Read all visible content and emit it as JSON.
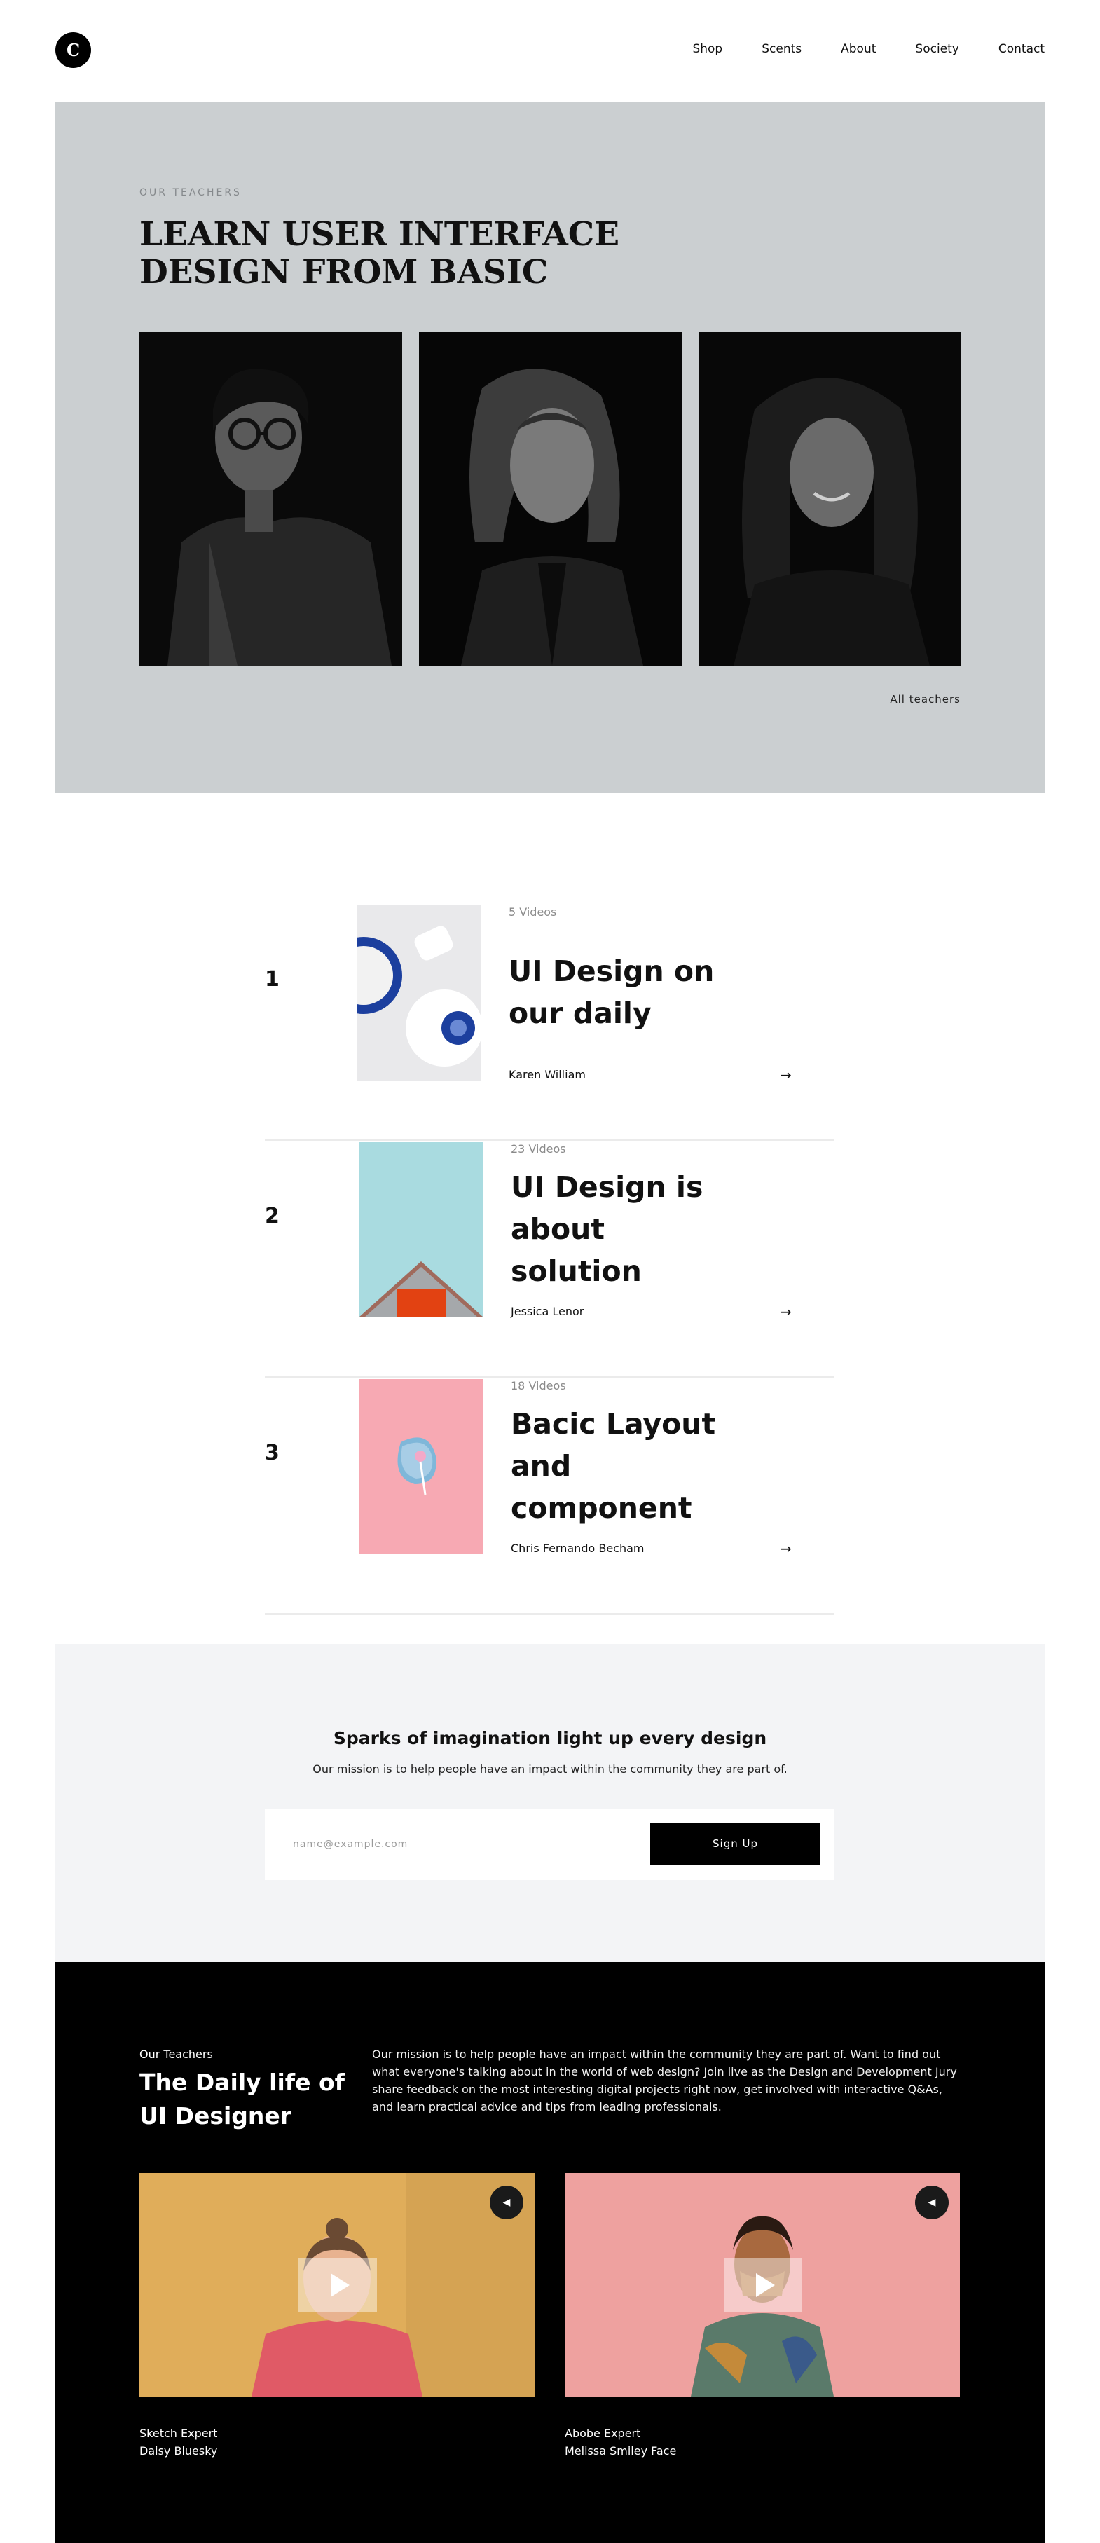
{
  "header": {
    "logo_letter": "C",
    "nav": [
      "Shop",
      "Scents",
      "About",
      "Society",
      "Contact"
    ]
  },
  "hero": {
    "eyebrow": "OUR TEACHERS",
    "title": "LEARN USER INTERFACE DESIGN FROM BASIC",
    "all_link": "All teachers",
    "background_color": "#cbcfd1"
  },
  "courses": [
    {
      "number": "1",
      "videos": "5 Videos",
      "title": "UI Design on our daily",
      "author": "Karen William"
    },
    {
      "number": "2",
      "videos": "23 Videos",
      "title": "UI Design is about solution",
      "author": "Jessica Lenor"
    },
    {
      "number": "3",
      "videos": "18 Videos",
      "title": "Bacic Layout and component",
      "author": "Chris Fernando Becham"
    }
  ],
  "newsletter": {
    "heading": "Sparks of imagination light up every design",
    "text": "Our mission is to help people have an impact within the community they are part of.",
    "placeholder": "name@example.com",
    "button": "Sign Up"
  },
  "daily": {
    "eyebrow": "Our Teachers",
    "title": "The Daily life of UI Designer",
    "description": "Our mission is to help people have an impact within the community they are part of. Want to find out what everyone's talking about in the world of web design? Join live as the Design and Development Jury share feedback on the most interesting digital projects right now, get involved with interactive Q&As, and learn practical advice and tips from leading professionals.",
    "videos": [
      {
        "role": "Sketch Expert",
        "name": "Daisy Bluesky",
        "background": "#e0ad5a"
      },
      {
        "role": "Abobe Expert",
        "name": "Melissa Smiley Face",
        "background": "#eea19f"
      }
    ]
  }
}
